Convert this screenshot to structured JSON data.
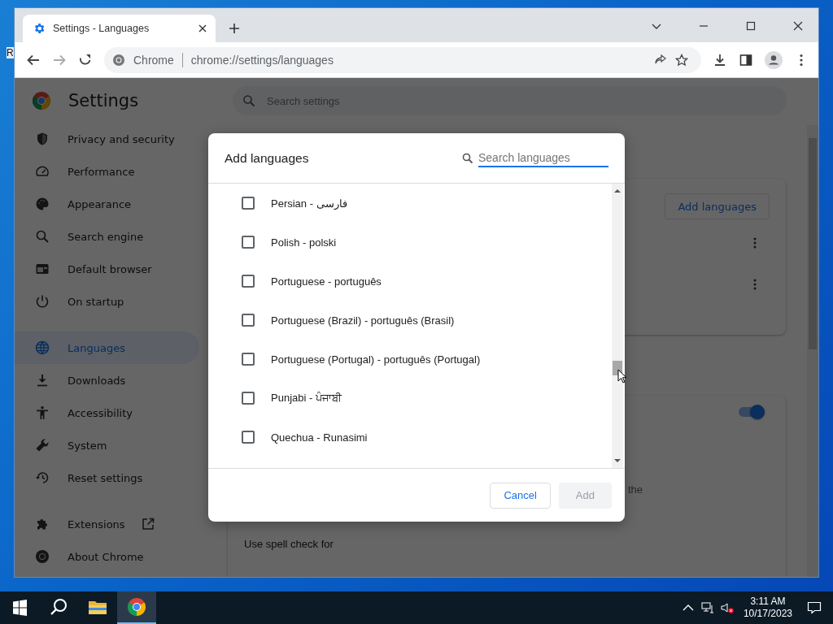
{
  "desktop": {
    "icon_label": "R"
  },
  "window": {
    "tab_title": "Settings - Languages",
    "site_chip": "Chrome",
    "url": "chrome://settings/languages"
  },
  "sidebar": {
    "title": "Settings",
    "groups": [
      [
        {
          "label": "Privacy and security",
          "selected": false
        },
        {
          "label": "Performance",
          "selected": false
        },
        {
          "label": "Appearance",
          "selected": false
        },
        {
          "label": "Search engine",
          "selected": false
        },
        {
          "label": "Default browser",
          "selected": false
        },
        {
          "label": "On startup",
          "selected": false
        }
      ],
      [
        {
          "label": "Languages",
          "selected": true
        },
        {
          "label": "Downloads",
          "selected": false
        },
        {
          "label": "Accessibility",
          "selected": false
        },
        {
          "label": "System",
          "selected": false
        },
        {
          "label": "Reset settings",
          "selected": false
        }
      ],
      [
        {
          "label": "Extensions",
          "selected": false,
          "external": true
        },
        {
          "label": "About Chrome",
          "selected": false,
          "external": false
        }
      ]
    ]
  },
  "main": {
    "search_placeholder": "Search settings",
    "add_button": "Add languages",
    "spell_toggle_on": true,
    "partial_text": "the",
    "spell_label": "Use spell check for"
  },
  "dialog": {
    "title": "Add languages",
    "search_placeholder": "Search languages",
    "languages": [
      {
        "label": "Persian - فارسی",
        "checked": false
      },
      {
        "label": "Polish - polski",
        "checked": false
      },
      {
        "label": "Portuguese - português",
        "checked": false
      },
      {
        "label": "Portuguese (Brazil) - português (Brasil)",
        "checked": false
      },
      {
        "label": "Portuguese (Portugal) - português (Portugal)",
        "checked": false
      },
      {
        "label": "Punjabi - ਪੰਜਾਬੀ",
        "checked": false
      },
      {
        "label": "Quechua - Runasimi",
        "checked": false
      }
    ],
    "cancel": "Cancel",
    "add": {
      "label": "Add",
      "disabled": true
    }
  },
  "taskbar": {
    "time": "3:11 AM",
    "date": "10/17/2023"
  }
}
